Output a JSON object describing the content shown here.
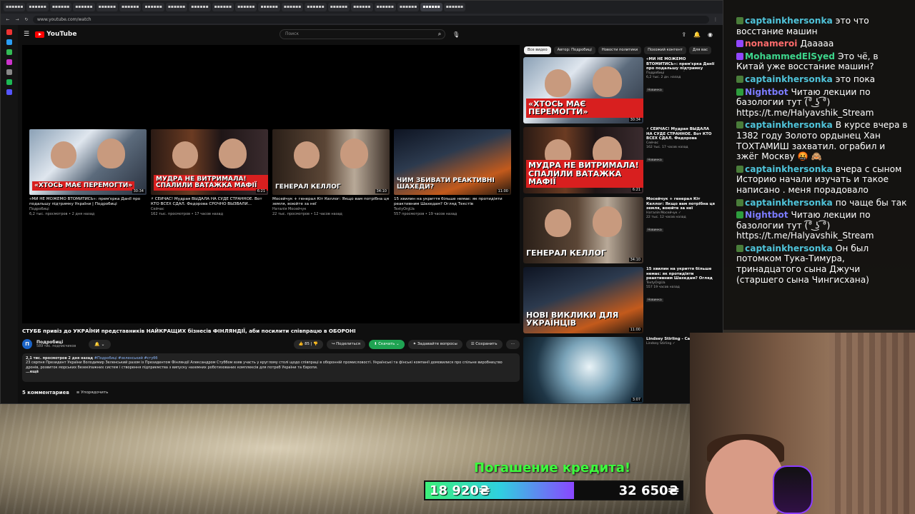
{
  "browser": {
    "tabs": [
      "▪▪▪▪▪▪",
      "▪▪▪▪▪▪",
      "▪▪▪▪▪▪",
      "▪▪▪▪▪▪",
      "▪▪▪▪▪▪",
      "▪▪▪▪▪▪",
      "▪▪▪▪▪▪",
      "▪▪▪▪▪▪",
      "▪▪▪▪▪▪",
      "▪▪▪▪▪▪",
      "▪▪▪▪▪▪",
      "▪▪▪▪▪▪",
      "▪▪▪▪▪▪",
      "▪▪▪▪▪▪",
      "▪▪▪▪▪▪",
      "▪▪▪▪▪▪",
      "▪▪▪▪▪▪",
      "▪▪▪▪▪▪",
      "▪▪▪▪▪▪",
      "▪▪▪▪▪▪"
    ],
    "url": "www.youtube.com/watch"
  },
  "youtube": {
    "logo_text": "YouTube",
    "search_placeholder": "Поиск",
    "video_title": "СТУББ привіз до УКРАЇНИ представників НАЙКРАЩИХ бізнесів ФІНЛЯНДІЇ, аби посилити співпрацю в ОБОРОНІ",
    "channel": {
      "avatar_letter": "П",
      "name": "Подробиці",
      "subs": "589 тис. подписчиков"
    },
    "actions": {
      "likes": "85",
      "share": "Поделиться",
      "download": "Скачать",
      "ask": "Задавайте вопросы",
      "save": "Сохранить"
    },
    "description": {
      "meta": "2,1 тис. просмотров  2 дня назад",
      "tags": "#Подробиці #зеленський #стубб",
      "text": "23 серпня Президент України Володимир Зеленський разом із Президентом Фінляндії Александром Стуббом взяв участь у круглому столі щодо співпраці в оборонній промисловості. Українські та фінські компанії домовилися про спільне виробництво дронів, розвиток морських безекіпажних систем і створення підприємства з випуску наземних роботизованих комплексів для потреб України та Європи.",
      "more": "...ещё"
    },
    "comments": {
      "count": "5 комментариев",
      "sort": "Упорядочить"
    },
    "endscreen": [
      {
        "title": "«МИ НЕ МОЖЕМО ВТОМИТИСЬ»: прем'єрка Данії про подальшу підтримку України | Подробиці",
        "channel": "Подробиці",
        "meta": "6,2 тыс. просмотров • 2 дня назад",
        "caption": "«ХТОСЬ МАЄ ПЕРЕМОГТИ»",
        "duration": "30:34",
        "art": "art-crowd"
      },
      {
        "title": "⚡ СЕЙЧАС! Мудрая ВЫДАЛА НА СУДЕ СТРАННОЕ. Вот КТО ВСЕХ СДАЛ. Федорова СРОЧНО ВЫЗВАЛИ...",
        "channel": "Сейчас",
        "meta": "162 тыс. просмотров • 17 часов назад",
        "caption": "МУДРА НЕ ВИТРИМАЛА! СПАЛИЛИ ВАТАЖКА МАФІЇ",
        "duration": "6:21",
        "art": "art-red"
      },
      {
        "title": "Мосейчук + генерал Кіт Келлог: Якщо вам потрібна ця земля, воюйте за неї",
        "channel": "Наталія Мосейчук",
        "meta": "22 тыс. просмотров • 12 часов назад",
        "caption": "ГЕНЕРАЛ КЕЛЛОГ",
        "duration": "34:10",
        "art": "art-studio"
      },
      {
        "title": "15 хвилин на укриття більше немає: як протидіяти реактивним Шахедам? Огляд Текстів",
        "channel": "TextyOrgUa",
        "meta": "557 просмотров • 19 часов назад",
        "caption": "ЧИМ ЗБИВАТИ РЕАКТИВНІ ШАХЕДИ?",
        "duration": "11:00",
        "art": "art-drone"
      }
    ],
    "chips": [
      "Все видео",
      "Автор: Подробиці",
      "Новости политики",
      "Похожий контент",
      "Для вас"
    ],
    "sidebar": [
      {
        "title": "«МИ НЕ МОЖЕМО ВТОМИТИСЬ»: прем'єрка Данії про подальшу підтримку України | Подробиці",
        "channel": "Подробиці",
        "meta": "6,2 тыс.  2 дн. назад",
        "badge": "Новинка",
        "caption": "«ХТОСЬ МАЄ ПЕРЕМОГТИ»",
        "duration": "30:34",
        "art": "art-crowd"
      },
      {
        "title": "⚡ СЕЙЧАС! Мудрая ВЫДАЛА НА СУДЕ СТРАННОЕ. Вот КТО ВСЕХ СДАЛ. Федорова СРОЧНО ВЫЗВАЛ...",
        "channel": "Сейчас",
        "meta": "162 тыс.  17 часов назад",
        "badge": "Новинка",
        "caption": "МУДРА НЕ ВИТРИМАЛА! СПАЛИЛИ ВАТАЖКА МАФІЇ",
        "duration": "6:21",
        "art": "art-red"
      },
      {
        "title": "Мосейчук + генерал Кіт Келлог: Якщо вам потрібна ця земля, воюйте за неї",
        "channel": "Наталія Мосейчук ✓",
        "meta": "22 тыс.  12 часов назад",
        "badge": "Новинка",
        "caption": "ГЕНЕРАЛ КЕЛЛОГ",
        "duration": "34:10",
        "art": "art-studio"
      },
      {
        "title": "15 хвилин на укриття більше немає: як протидіяти реактивним Шахедам? Огляд Текстів",
        "channel": "TextyOrgUa",
        "meta": "557  19 часов назад",
        "badge": "Новинка",
        "caption": "НОВІ ВИКЛИКИ ДЛЯ УКРАЇНЦІВ",
        "duration": "11:00",
        "art": "art-drone"
      },
      {
        "title": "Lindsey Stirling - Carol of",
        "channel": "Lindsey Stirling ✓",
        "meta": "",
        "badge": "",
        "caption": "",
        "duration": "3:07",
        "art": "art-violin"
      }
    ]
  },
  "chat": [
    {
      "user": "captainkhersonka",
      "color": "#4fc3d9",
      "badge": "#4a7d3a",
      "text": "это что восстание машин"
    },
    {
      "user": "nonameroi",
      "color": "#ff6b6b",
      "badge": "#9147ff",
      "text": "Дааааа"
    },
    {
      "user": "MohammedElSyed",
      "color": "#3dd68c",
      "badge": "#9147ff",
      "text": "Это чё, в Китай уже восстание машин?"
    },
    {
      "user": "captainkhersonka",
      "color": "#4fc3d9",
      "badge": "#4a7d3a",
      "text": "это пока"
    },
    {
      "user": "Nightbot",
      "color": "#7b7bff",
      "badge": "#2e9e3e",
      "text": "Читаю лекции по базологии тут (͡° ͜ʖ ͡°) https://t.me/Halyavshik_Stream"
    },
    {
      "user": "captainkhersonka",
      "color": "#4fc3d9",
      "badge": "#4a7d3a",
      "text": "В курсе вчера в 1382 году Золото ордынец Хан ТОХТАМИШ захватил. ограбил и зжёг Москву 🤬 🙈"
    },
    {
      "user": "captainkhersonka",
      "color": "#4fc3d9",
      "badge": "#4a7d3a",
      "text": "вчера с сыном Историю начали изучать и такое написано . меня порадовало"
    },
    {
      "user": "captainkhersonka",
      "color": "#4fc3d9",
      "badge": "#4a7d3a",
      "text": "по чаще бы так"
    },
    {
      "user": "Nightbot",
      "color": "#7b7bff",
      "badge": "#2e9e3e",
      "text": "Читаю лекции по базологии тут (͡° ͜ʖ ͡°) https://t.me/Halyavshik_Stream"
    },
    {
      "user": "captainkhersonka",
      "color": "#4fc3d9",
      "badge": "#4a7d3a",
      "text": "Он был потомком Тука-Тимура, тринадцатого сына Джучи (старшего сына Чингисхана)"
    }
  ],
  "goal": {
    "title": "Погашение кредита!",
    "current": "18 920₴",
    "target": "32 650₴",
    "progress": 0.579
  }
}
